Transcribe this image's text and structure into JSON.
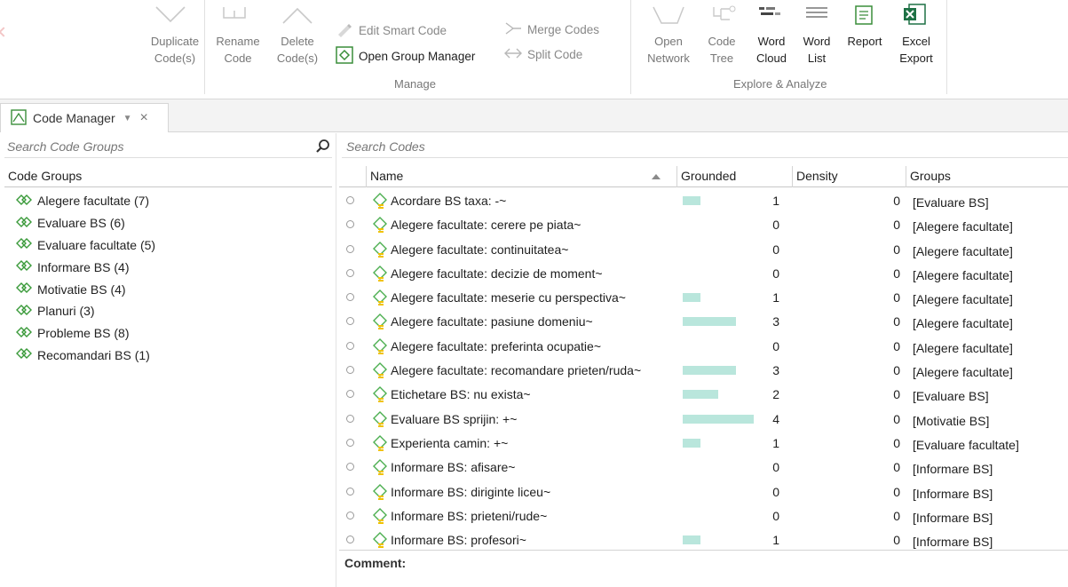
{
  "ribbon": {
    "buttons": {
      "duplicate": "Duplicate\nCode(s)",
      "rename": "Rename\nCode",
      "delete": "Delete\nCode(s)",
      "open_network": "Open\nNetwork",
      "code_tree": "Code\nTree",
      "word_cloud": "Word\nCloud",
      "word_list": "Word\nList",
      "report": "Report",
      "excel_export": "Excel\nExport"
    },
    "small": {
      "edit_smart_code": "Edit Smart Code",
      "open_group_manager": "Open Group Manager",
      "merge_codes": "Merge Codes",
      "split_code": "Split Code"
    },
    "groups": {
      "manage": "Manage",
      "explore": "Explore & Analyze"
    }
  },
  "tab": {
    "label": "Code Manager"
  },
  "left": {
    "search_placeholder": "Search Code Groups",
    "header": "Code Groups",
    "groups": [
      "Alegere facultate (7)",
      "Evaluare BS (6)",
      "Evaluare facultate (5)",
      "Informare BS (4)",
      "Motivatie BS (4)",
      "Planuri (3)",
      "Probleme BS (8)",
      "Recomandari BS (1)"
    ]
  },
  "right": {
    "search_placeholder": "Search Codes",
    "columns": {
      "name": "Name",
      "grounded": "Grounded",
      "density": "Density",
      "groups": "Groups"
    },
    "codes": [
      {
        "name": "Acordare BS taxa: -~",
        "grounded": "1",
        "density": "0",
        "groups": "[Evaluare BS]"
      },
      {
        "name": "Alegere facultate: cerere pe piata~",
        "grounded": "0",
        "density": "0",
        "groups": "[Alegere facultate]"
      },
      {
        "name": "Alegere facultate: continuitatea~",
        "grounded": "0",
        "density": "0",
        "groups": "[Alegere facultate]"
      },
      {
        "name": "Alegere facultate: decizie de moment~",
        "grounded": "0",
        "density": "0",
        "groups": "[Alegere facultate]"
      },
      {
        "name": "Alegere facultate: meserie cu perspectiva~",
        "grounded": "1",
        "density": "0",
        "groups": "[Alegere facultate]"
      },
      {
        "name": "Alegere facultate: pasiune domeniu~",
        "grounded": "3",
        "density": "0",
        "groups": "[Alegere facultate]"
      },
      {
        "name": "Alegere facultate: preferinta ocupatie~",
        "grounded": "0",
        "density": "0",
        "groups": "[Alegere facultate]"
      },
      {
        "name": "Alegere facultate: recomandare prieten/ruda~",
        "grounded": "3",
        "density": "0",
        "groups": "[Alegere facultate]"
      },
      {
        "name": "Etichetare BS: nu exista~",
        "grounded": "2",
        "density": "0",
        "groups": "[Evaluare BS]"
      },
      {
        "name": "Evaluare BS sprijin: +~",
        "grounded": "4",
        "density": "0",
        "groups": "[Motivatie BS]"
      },
      {
        "name": "Experienta camin: +~",
        "grounded": "1",
        "density": "0",
        "groups": "[Evaluare facultate]"
      },
      {
        "name": "Informare BS: afisare~",
        "grounded": "0",
        "density": "0",
        "groups": "[Informare BS]"
      },
      {
        "name": "Informare BS: diriginte liceu~",
        "grounded": "0",
        "density": "0",
        "groups": "[Informare BS]"
      },
      {
        "name": "Informare BS: prieteni/rude~",
        "grounded": "0",
        "density": "0",
        "groups": "[Informare BS]"
      },
      {
        "name": "Informare BS: profesori~",
        "grounded": "1",
        "density": "0",
        "groups": "[Informare BS]"
      }
    ],
    "comment_label": "Comment:"
  },
  "colors": {
    "bar": "#b9e6dc",
    "code_icon": "#4caf50",
    "accent_yellow": "#f2c200"
  }
}
